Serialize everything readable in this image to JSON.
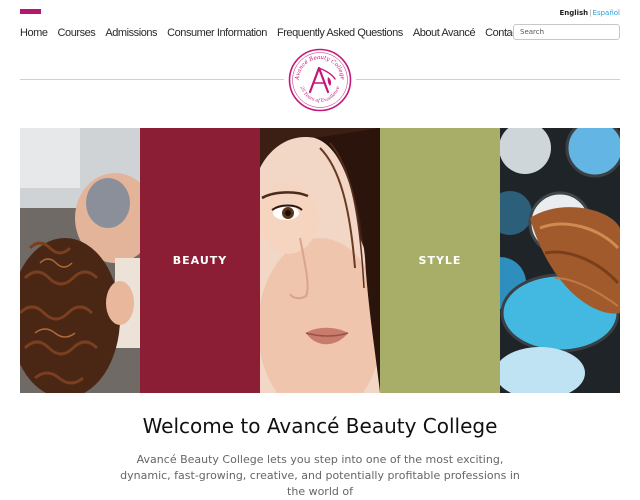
{
  "header": {
    "lang_active": "English",
    "lang_separator": "|",
    "lang_other": "Español",
    "accent_color": "#b5166e"
  },
  "nav": {
    "items": [
      "Home",
      "Courses",
      "Admissions",
      "Consumer Information",
      "Frequently Asked Questions",
      "About Avancé",
      "Contact Us"
    ]
  },
  "search": {
    "placeholder": "Search"
  },
  "logo": {
    "arc_text_top": "Avancé Beauty College",
    "arc_text_bottom": "25 Years of Excellence",
    "color": "#c4177a"
  },
  "hero": {
    "panels": [
      {
        "kind": "photo",
        "subject": "curly-hair-styling"
      },
      {
        "kind": "text",
        "label": "BEAUTY",
        "color": "#8b1e34"
      },
      {
        "kind": "photo",
        "subject": "model-face"
      },
      {
        "kind": "text",
        "label": "STYLE",
        "color": "#a8ad68"
      },
      {
        "kind": "photo",
        "subject": "makeup-brush-eyeshadow"
      }
    ]
  },
  "main": {
    "title": "Welcome to Avancé Beauty College",
    "intro": "Avancé Beauty College lets you step into one of the most exciting, dynamic, fast-growing, creative, and potentially profitable professions in the world of"
  }
}
